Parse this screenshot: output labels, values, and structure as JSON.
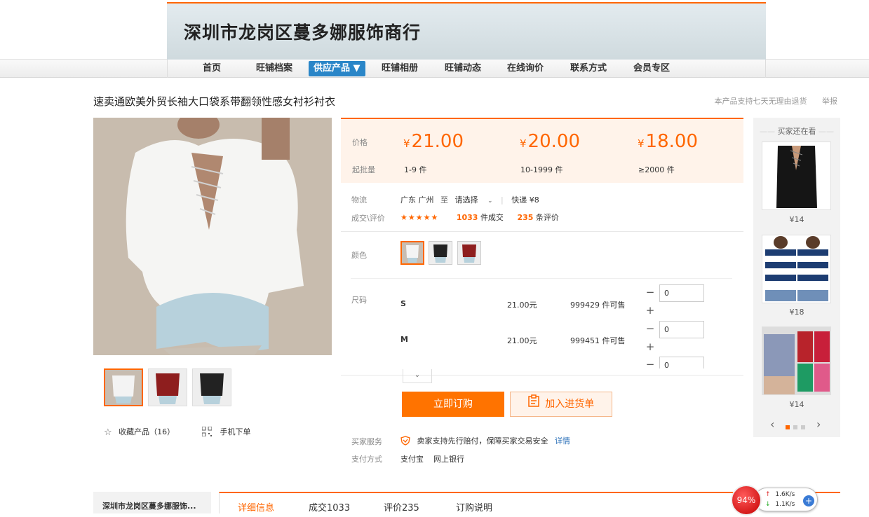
{
  "shop": {
    "name": "深圳市龙岗区蔓多娜服饰商行"
  },
  "nav": {
    "items": [
      "首页",
      "旺铺档案",
      "供应产品 ▼",
      "旺铺相册",
      "旺铺动态",
      "在线询价",
      "联系方式",
      "会员专区"
    ],
    "active_index": 2
  },
  "product": {
    "title": "速卖通欧美外贸长袖大口袋系带翻领性感女衬衫衬衣",
    "return_policy": "本产品支持七天无理由退货",
    "report": "举报",
    "fav_label": "收藏产品（16）",
    "mobile_label": "手机下单"
  },
  "pricing": {
    "price_label": "价格",
    "moq_label": "起批量",
    "tiers": [
      {
        "currency": "¥",
        "price": "21.00",
        "range": "1-9 件"
      },
      {
        "currency": "¥",
        "price": "20.00",
        "range": "10-1999 件"
      },
      {
        "currency": "¥",
        "price": "18.00",
        "range": "≥2000 件"
      }
    ]
  },
  "logistics": {
    "label": "物流",
    "from": "广东 广州",
    "to_word": "至",
    "select": "请选择",
    "express": "快递 ¥8"
  },
  "deals": {
    "label": "成交\\评价",
    "stars": "★★★★★",
    "deals_count": "1033",
    "deals_suffix": "件成交",
    "reviews_count": "235",
    "reviews_suffix": "条评价"
  },
  "color": {
    "label": "颜色",
    "swatches": [
      "white",
      "black",
      "red"
    ]
  },
  "sizes": {
    "label": "尺码",
    "rows": [
      {
        "name": "S",
        "price": "21.00元",
        "stock": "999429 件可售",
        "qty": "0"
      },
      {
        "name": "M",
        "price": "21.00元",
        "stock": "999451 件可售",
        "qty": "0"
      },
      {
        "name": "",
        "price": "",
        "stock": "",
        "qty": "0"
      }
    ]
  },
  "actions": {
    "order": "立即订购",
    "cart": "加入进货单"
  },
  "services": {
    "buyer_label": "买家服务",
    "buyer_text": "卖家支持先行赔付，保障买家交易安全",
    "buyer_link": "详情",
    "pay_label": "支付方式",
    "pay_methods": "支付宝    网上银行"
  },
  "sidebar": {
    "title": "买家还在看",
    "items": [
      {
        "price": "¥14"
      },
      {
        "price": "¥18"
      },
      {
        "price": "¥14"
      }
    ]
  },
  "bottom": {
    "shop_name": "深圳市龙岗区蔓多娜服饰...",
    "tabs": [
      "详细信息",
      "成交1033",
      "评价235",
      "订购说明"
    ]
  },
  "widget": {
    "percent": "94%",
    "up": "1.6K/s",
    "down": "1.1K/s"
  },
  "colors": {
    "accent": "#ff6600",
    "nav_active": "#2a86c8"
  }
}
